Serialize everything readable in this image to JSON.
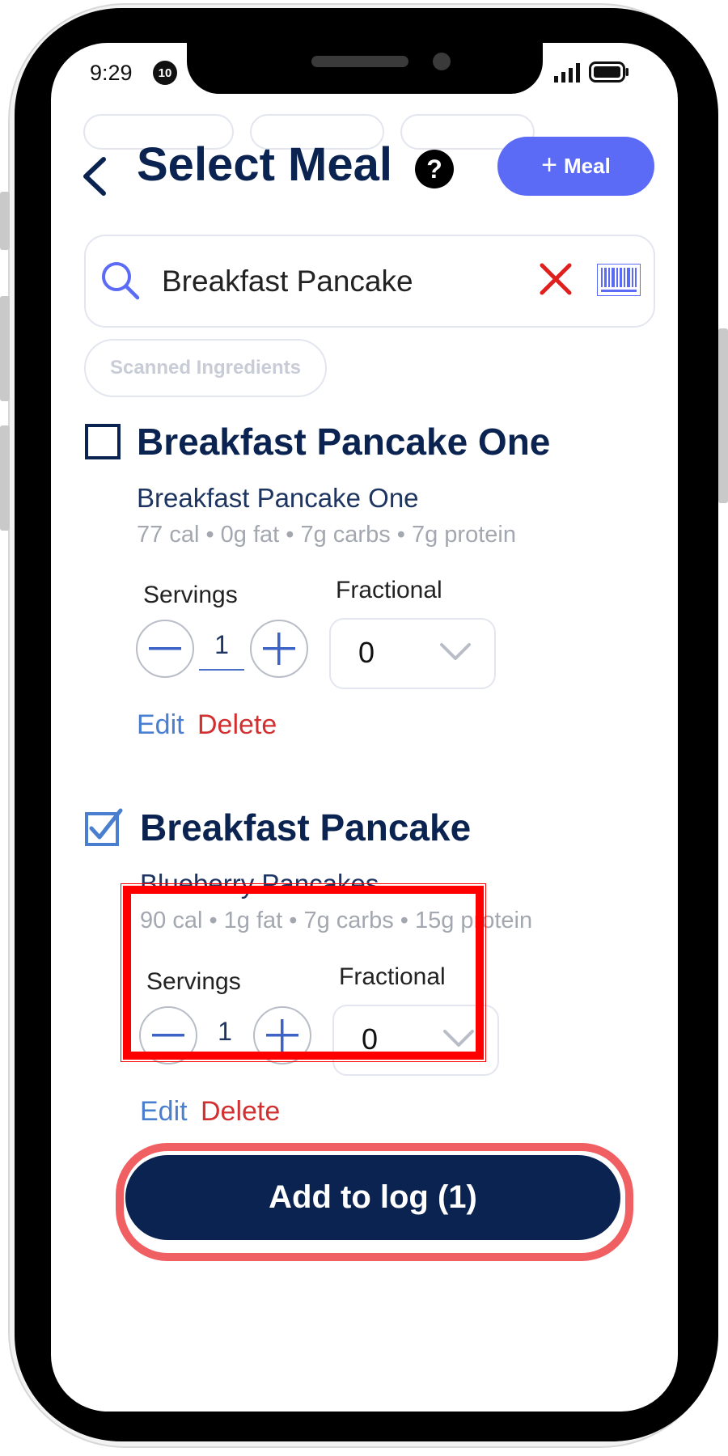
{
  "status_bar": {
    "time": "9:29",
    "notification_count": "10"
  },
  "header": {
    "title": "Select Meal",
    "help_label": "?",
    "add_meal_label": "Meal",
    "add_meal_icon": "+"
  },
  "search": {
    "value": "Breakfast Pancake",
    "clear_icon": "close-icon",
    "barcode_icon": "barcode-icon"
  },
  "chips": {
    "scanned_ingredients": "Scanned Ingredients"
  },
  "meals": [
    {
      "title": "Breakfast Pancake One",
      "checked": false,
      "subtitle": "Breakfast Pancake One",
      "nutrition": "77 cal • 0g fat • 7g carbs • 7g protein",
      "servings_label": "Servings",
      "servings": "1",
      "fractional_label": "Fractional",
      "fractional": "0",
      "edit_label": "Edit",
      "delete_label": "Delete"
    },
    {
      "title": "Breakfast Pancake",
      "checked": true,
      "subtitle": "Blueberry Pancakes",
      "nutrition": "90 cal • 1g fat • 7g carbs • 15g protein",
      "servings_label": "Servings",
      "servings": "1",
      "fractional_label": "Fractional",
      "fractional": "0",
      "edit_label": "Edit",
      "delete_label": "Delete"
    }
  ],
  "cta": {
    "label": "Add to log (1)"
  },
  "colors": {
    "navy": "#0b2350",
    "accent": "#5b6bf5",
    "link": "#4a7fd0",
    "danger": "#d23030",
    "highlight": "#ff0000",
    "cta_highlight": "#f06063"
  }
}
